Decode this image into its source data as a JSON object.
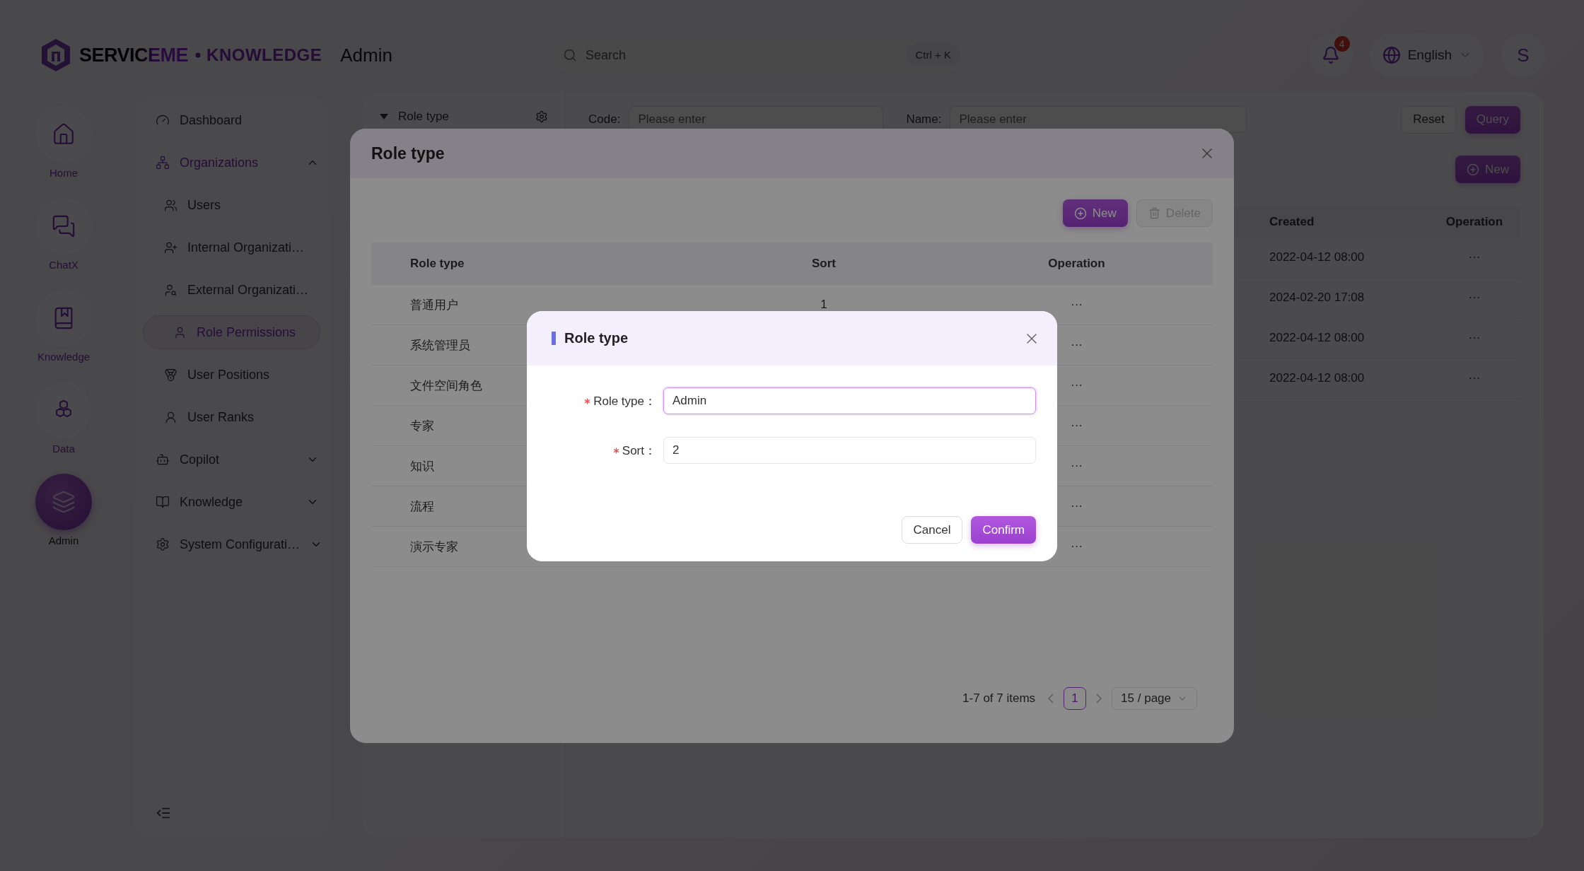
{
  "header": {
    "brand": {
      "name": "SERVICEME",
      "product": "KNOWLEDGE"
    },
    "page_title": "Admin",
    "search": {
      "placeholder": "Search",
      "shortcut": "Ctrl + K"
    },
    "notifications": {
      "count": "4"
    },
    "language": "English",
    "avatar": "S"
  },
  "rail": [
    {
      "label": "Home",
      "selected": false
    },
    {
      "label": "ChatX",
      "selected": false
    },
    {
      "label": "Knowledge",
      "selected": false
    },
    {
      "label": "Data",
      "selected": false
    },
    {
      "label": "Admin",
      "selected": true
    }
  ],
  "sidebar": {
    "items": [
      {
        "label": "Dashboard",
        "selected": false
      },
      {
        "label": "Organizations",
        "expanded": true,
        "children": [
          {
            "label": "Users",
            "selected": false
          },
          {
            "label": "Internal Organizati…",
            "selected": false
          },
          {
            "label": "External Organizati…",
            "selected": false
          },
          {
            "label": "Role Permissions",
            "selected": true
          },
          {
            "label": "User Positions",
            "selected": false
          },
          {
            "label": "User Ranks",
            "selected": false
          }
        ]
      },
      {
        "label": "Copilot",
        "expanded": false
      },
      {
        "label": "Knowledge",
        "expanded": false
      },
      {
        "label": "System Configurati…",
        "expanded": false
      }
    ]
  },
  "main": {
    "tree_header": "Role type",
    "filters": [
      {
        "label": "Code:",
        "placeholder": "Please enter"
      },
      {
        "label": "Name:",
        "placeholder": "Please enter"
      }
    ],
    "actions": [
      "Reset",
      "Query"
    ],
    "new_button": "New",
    "table": {
      "columns": [
        "Created",
        "Operation"
      ],
      "rows": [
        {
          "created": "2022-04-12 08:00",
          "operation": "···"
        },
        {
          "created": "2024-02-20 17:08",
          "operation": "···"
        },
        {
          "created": "2022-04-12 08:00",
          "operation": "···"
        },
        {
          "created": "2022-04-12 08:00",
          "operation": "···"
        }
      ]
    }
  },
  "modal": {
    "title": "Role type",
    "toolbar": [
      {
        "label": "New",
        "kind": "primary",
        "disabled": false
      },
      {
        "label": "Delete",
        "kind": "delete",
        "disabled": true
      }
    ],
    "columns": [
      "Role type",
      "Sort",
      "Operation"
    ],
    "rows": [
      {
        "role_type": "普通用户",
        "sort": "1",
        "operation": "···"
      },
      {
        "role_type": "系统管理员",
        "operation": "···"
      },
      {
        "role_type": "文件空间角色",
        "operation": "···"
      },
      {
        "role_type": "专家",
        "operation": "···"
      },
      {
        "role_type": "知识",
        "operation": "···"
      },
      {
        "role_type": "流程",
        "operation": "···"
      },
      {
        "role_type": "演示专家",
        "operation": "···"
      }
    ],
    "pagination": {
      "summary": "1-7 of 7 items",
      "pages": [
        {
          "label": "1",
          "selected": true
        }
      ],
      "page_size": "15 / page"
    }
  },
  "dialog": {
    "title": "Role type",
    "fields": [
      {
        "label": "Role type：",
        "required": true,
        "value": "Admin",
        "focused": true
      },
      {
        "label": "Sort：",
        "required": true,
        "value": "2",
        "focused": false
      }
    ],
    "buttons": [
      {
        "label": "Cancel",
        "kind": "default"
      },
      {
        "label": "Confirm",
        "kind": "primary"
      }
    ]
  }
}
